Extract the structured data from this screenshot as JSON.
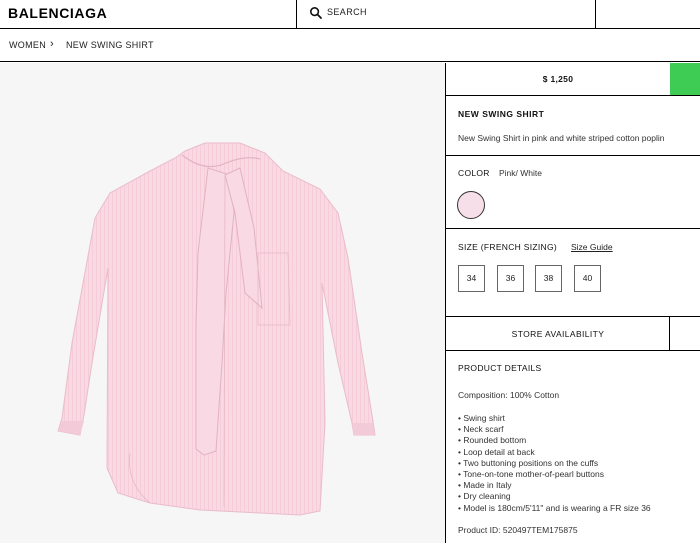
{
  "header": {
    "logo": "BALENCIAGA",
    "search_label": "SEARCH",
    "search_icon": "search-icon"
  },
  "breadcrumb": {
    "items": [
      "WOMEN",
      "NEW SWING SHIRT"
    ],
    "separator": "›"
  },
  "product": {
    "price": "$ 1,250",
    "name": "NEW SWING SHIRT",
    "description": "New Swing Shirt in pink and white striped cotton poplin",
    "color_label": "COLOR",
    "color_value": "Pink/ White",
    "swatch_color": "#f7dfea",
    "size_label": "SIZE (FRENCH SIZING)",
    "size_guide": "Size Guide",
    "sizes": [
      "34",
      "36",
      "38",
      "40"
    ],
    "store_availability": "STORE AVAILABILITY",
    "accent_color": "#3ecc55"
  },
  "details": {
    "title": "PRODUCT DETAILS",
    "composition": "Composition: 100% Cotton",
    "bullets": [
      "• Swing shirt",
      "• Neck scarf",
      "• Rounded bottom",
      "• Loop detail at back",
      "• Two buttoning positions on the cuffs",
      "• Tone-on-tone mother-of-pearl buttons",
      "• Made in Italy",
      "• Dry cleaning",
      "• Model is 180cm/5'11\" and is wearing a FR size 36"
    ],
    "product_id": "Product ID: 520497TEM175875"
  }
}
